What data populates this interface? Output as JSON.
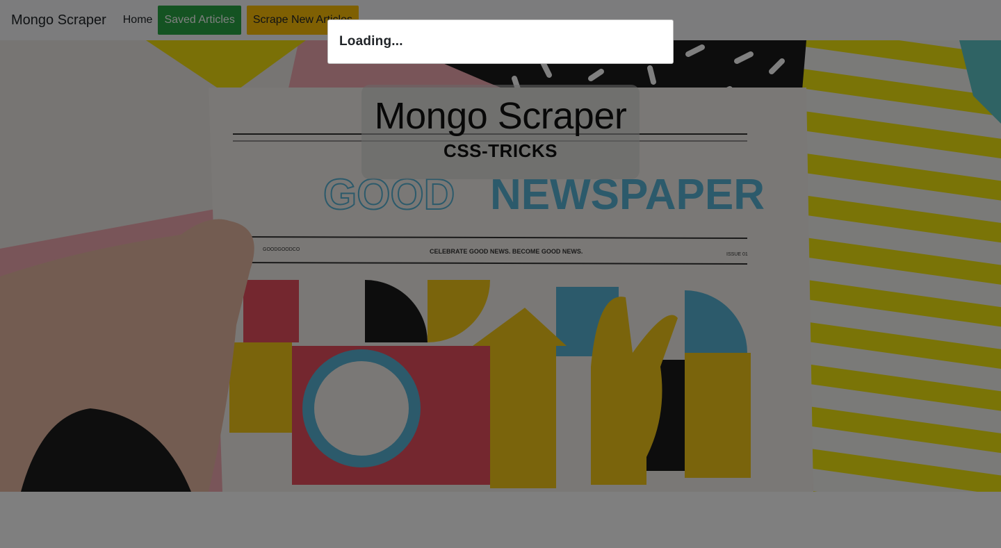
{
  "navbar": {
    "brand": "Mongo Scraper",
    "home_label": "Home",
    "saved_label": "Saved Articles",
    "scrape_label": "Scrape New Articles"
  },
  "hero": {
    "title": "Mongo Scraper",
    "subtitle": "CSS-TRICKS",
    "newspaper_masthead": "NEWSPAPER",
    "newspaper_masthead_prefix": "GOOD",
    "newspaper_tagline": "CELEBRATE GOOD NEWS. BECOME GOOD NEWS.",
    "newspaper_issue": "ISSUE 01",
    "newspaper_code": "GOODGOODCO"
  },
  "modal": {
    "title": "Loading..."
  },
  "colors": {
    "saved_button": "#28a745",
    "scrape_button": "#ffc107",
    "navbar_bg": "#f8f9fa",
    "backdrop": "rgba(0,0,0,0.5)"
  }
}
